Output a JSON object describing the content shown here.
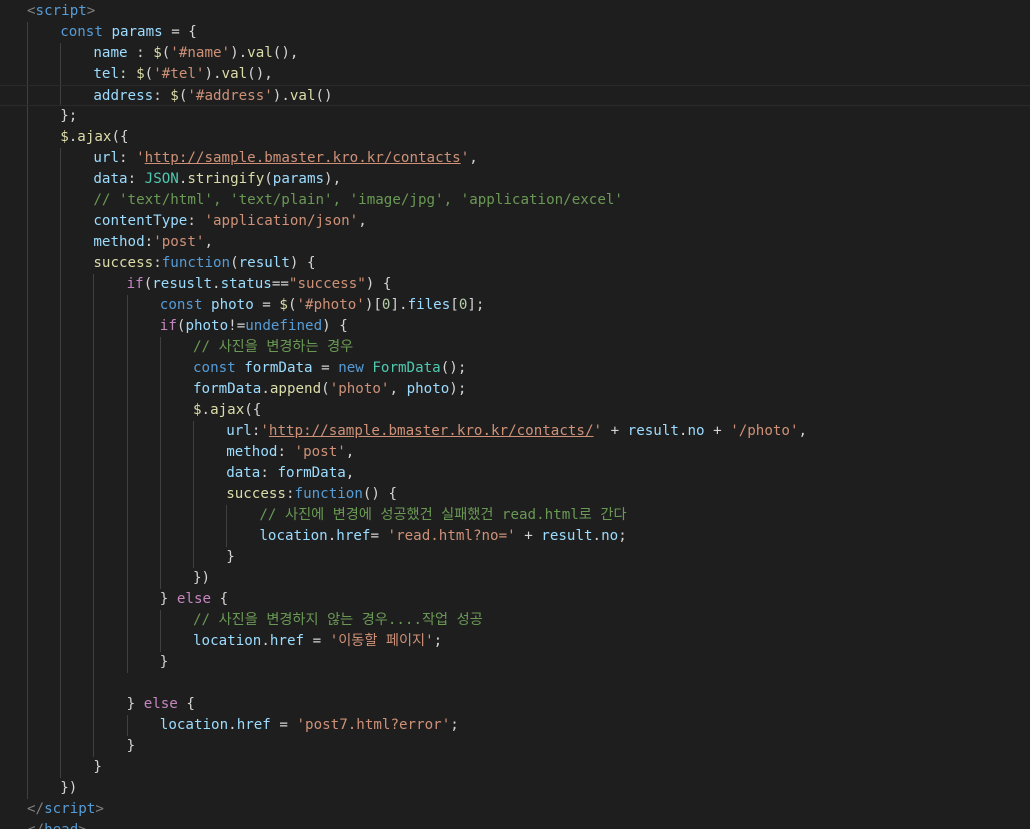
{
  "editor": {
    "language": "html",
    "theme_colors": {
      "background": "#1e1e1e",
      "keyword": "#569cd6",
      "control": "#c586c0",
      "variable": "#9cdcfe",
      "function": "#dcdcaa",
      "string": "#ce9178",
      "number": "#b5cea8",
      "comment": "#6a9955",
      "class": "#4ec9b0",
      "text": "#d4d4d4",
      "tag_bracket": "#808080"
    },
    "current_line_index": 4,
    "lines": [
      {
        "indent": 0,
        "tokens": [
          [
            "tag-bracket",
            "<"
          ],
          [
            "tag",
            "script"
          ],
          [
            "tag-bracket",
            ">"
          ]
        ]
      },
      {
        "indent": 1,
        "tokens": [
          [
            "kw",
            "const "
          ],
          [
            "var",
            "params"
          ],
          [
            "plain",
            " = {"
          ]
        ]
      },
      {
        "indent": 2,
        "tokens": [
          [
            "var",
            "name"
          ],
          [
            "plain",
            " : "
          ],
          [
            "fn",
            "$"
          ],
          [
            "plain",
            "("
          ],
          [
            "str",
            "'#name'"
          ],
          [
            "plain",
            ")."
          ],
          [
            "fn",
            "val"
          ],
          [
            "plain",
            "(),"
          ]
        ]
      },
      {
        "indent": 2,
        "tokens": [
          [
            "var",
            "tel"
          ],
          [
            "plain",
            ": "
          ],
          [
            "fn",
            "$"
          ],
          [
            "plain",
            "("
          ],
          [
            "str",
            "'#tel'"
          ],
          [
            "plain",
            ")."
          ],
          [
            "fn",
            "val"
          ],
          [
            "plain",
            "(),"
          ]
        ]
      },
      {
        "indent": 2,
        "tokens": [
          [
            "var",
            "address"
          ],
          [
            "plain",
            ": "
          ],
          [
            "fn",
            "$"
          ],
          [
            "plain",
            "("
          ],
          [
            "str",
            "'#address'"
          ],
          [
            "plain",
            ")."
          ],
          [
            "fn",
            "val"
          ],
          [
            "plain",
            "()"
          ]
        ]
      },
      {
        "indent": 1,
        "tokens": [
          [
            "plain",
            "};"
          ]
        ]
      },
      {
        "indent": 1,
        "tokens": [
          [
            "fn",
            "$"
          ],
          [
            "plain",
            "."
          ],
          [
            "fn",
            "ajax"
          ],
          [
            "plain",
            "({"
          ]
        ]
      },
      {
        "indent": 2,
        "tokens": [
          [
            "var",
            "url"
          ],
          [
            "plain",
            ": "
          ],
          [
            "str",
            "'"
          ],
          [
            "url",
            "http://sample.bmaster.kro.kr/contacts"
          ],
          [
            "str",
            "'"
          ],
          [
            "plain",
            ","
          ]
        ]
      },
      {
        "indent": 2,
        "tokens": [
          [
            "var",
            "data"
          ],
          [
            "plain",
            ": "
          ],
          [
            "cls",
            "JSON"
          ],
          [
            "plain",
            "."
          ],
          [
            "fn",
            "stringify"
          ],
          [
            "plain",
            "("
          ],
          [
            "var",
            "params"
          ],
          [
            "plain",
            "),"
          ]
        ]
      },
      {
        "indent": 2,
        "tokens": [
          [
            "cmt",
            "// 'text/html', 'text/plain', 'image/jpg', 'application/excel'"
          ]
        ]
      },
      {
        "indent": 2,
        "tokens": [
          [
            "var",
            "contentType"
          ],
          [
            "plain",
            ": "
          ],
          [
            "str",
            "'application/json'"
          ],
          [
            "plain",
            ","
          ]
        ]
      },
      {
        "indent": 2,
        "tokens": [
          [
            "var",
            "method"
          ],
          [
            "plain",
            ":"
          ],
          [
            "str",
            "'post'"
          ],
          [
            "plain",
            ","
          ]
        ]
      },
      {
        "indent": 2,
        "tokens": [
          [
            "fn",
            "success"
          ],
          [
            "plain",
            ":"
          ],
          [
            "kw",
            "function"
          ],
          [
            "plain",
            "("
          ],
          [
            "var",
            "result"
          ],
          [
            "plain",
            ") {"
          ]
        ]
      },
      {
        "indent": 3,
        "tokens": [
          [
            "ctrl",
            "if"
          ],
          [
            "plain",
            "("
          ],
          [
            "var",
            "resuslt"
          ],
          [
            "plain",
            "."
          ],
          [
            "var",
            "status"
          ],
          [
            "plain",
            "=="
          ],
          [
            "str",
            "\"success\""
          ],
          [
            "plain",
            ") {"
          ]
        ]
      },
      {
        "indent": 4,
        "tokens": [
          [
            "kw",
            "const "
          ],
          [
            "var",
            "photo"
          ],
          [
            "plain",
            " = "
          ],
          [
            "fn",
            "$"
          ],
          [
            "plain",
            "("
          ],
          [
            "str",
            "'#photo'"
          ],
          [
            "plain",
            ")["
          ],
          [
            "num",
            "0"
          ],
          [
            "plain",
            "]."
          ],
          [
            "var",
            "files"
          ],
          [
            "plain",
            "["
          ],
          [
            "num",
            "0"
          ],
          [
            "plain",
            "];"
          ]
        ]
      },
      {
        "indent": 4,
        "tokens": [
          [
            "ctrl",
            "if"
          ],
          [
            "plain",
            "("
          ],
          [
            "var",
            "photo"
          ],
          [
            "plain",
            "!="
          ],
          [
            "kw",
            "undefined"
          ],
          [
            "plain",
            ") {"
          ]
        ]
      },
      {
        "indent": 5,
        "tokens": [
          [
            "cmt",
            "// 사진을 변경하는 경우"
          ]
        ]
      },
      {
        "indent": 5,
        "tokens": [
          [
            "kw",
            "const "
          ],
          [
            "var",
            "formData"
          ],
          [
            "plain",
            " = "
          ],
          [
            "kw",
            "new "
          ],
          [
            "cls",
            "FormData"
          ],
          [
            "plain",
            "();"
          ]
        ]
      },
      {
        "indent": 5,
        "tokens": [
          [
            "var",
            "formData"
          ],
          [
            "plain",
            "."
          ],
          [
            "fn",
            "append"
          ],
          [
            "plain",
            "("
          ],
          [
            "str",
            "'photo'"
          ],
          [
            "plain",
            ", "
          ],
          [
            "var",
            "photo"
          ],
          [
            "plain",
            ");"
          ]
        ]
      },
      {
        "indent": 5,
        "tokens": [
          [
            "fn",
            "$"
          ],
          [
            "plain",
            "."
          ],
          [
            "fn",
            "ajax"
          ],
          [
            "plain",
            "({"
          ]
        ]
      },
      {
        "indent": 6,
        "tokens": [
          [
            "var",
            "url"
          ],
          [
            "plain",
            ":"
          ],
          [
            "str",
            "'"
          ],
          [
            "url",
            "http://sample.bmaster.kro.kr/contacts/"
          ],
          [
            "str",
            "'"
          ],
          [
            "plain",
            " + "
          ],
          [
            "var",
            "result"
          ],
          [
            "plain",
            "."
          ],
          [
            "var",
            "no"
          ],
          [
            "plain",
            " + "
          ],
          [
            "str",
            "'/photo'"
          ],
          [
            "plain",
            ","
          ]
        ]
      },
      {
        "indent": 6,
        "tokens": [
          [
            "var",
            "method"
          ],
          [
            "plain",
            ": "
          ],
          [
            "str",
            "'post'"
          ],
          [
            "plain",
            ","
          ]
        ]
      },
      {
        "indent": 6,
        "tokens": [
          [
            "var",
            "data"
          ],
          [
            "plain",
            ": "
          ],
          [
            "var",
            "formData"
          ],
          [
            "plain",
            ","
          ]
        ]
      },
      {
        "indent": 6,
        "tokens": [
          [
            "fn",
            "success"
          ],
          [
            "plain",
            ":"
          ],
          [
            "kw",
            "function"
          ],
          [
            "plain",
            "() {"
          ]
        ]
      },
      {
        "indent": 7,
        "tokens": [
          [
            "cmt",
            "// 사진에 변경에 성공했건 실패했건 read.html로 간다"
          ]
        ]
      },
      {
        "indent": 7,
        "tokens": [
          [
            "var",
            "location"
          ],
          [
            "plain",
            "."
          ],
          [
            "var",
            "href"
          ],
          [
            "plain",
            "= "
          ],
          [
            "str",
            "'read.html?no='"
          ],
          [
            "plain",
            " + "
          ],
          [
            "var",
            "result"
          ],
          [
            "plain",
            "."
          ],
          [
            "var",
            "no"
          ],
          [
            "plain",
            ";"
          ]
        ]
      },
      {
        "indent": 6,
        "tokens": [
          [
            "plain",
            "}"
          ]
        ]
      },
      {
        "indent": 5,
        "tokens": [
          [
            "plain",
            "})"
          ]
        ]
      },
      {
        "indent": 4,
        "tokens": [
          [
            "plain",
            "} "
          ],
          [
            "ctrl",
            "else"
          ],
          [
            "plain",
            " {"
          ]
        ]
      },
      {
        "indent": 5,
        "tokens": [
          [
            "cmt",
            "// 사진을 변경하지 않는 경우....작업 성공"
          ]
        ]
      },
      {
        "indent": 5,
        "tokens": [
          [
            "var",
            "location"
          ],
          [
            "plain",
            "."
          ],
          [
            "var",
            "href"
          ],
          [
            "plain",
            " = "
          ],
          [
            "str",
            "'이동할 페이지'"
          ],
          [
            "plain",
            ";"
          ]
        ]
      },
      {
        "indent": 4,
        "tokens": [
          [
            "plain",
            "}"
          ]
        ]
      },
      {
        "indent": 0,
        "tokens": []
      },
      {
        "indent": 3,
        "tokens": [
          [
            "plain",
            "} "
          ],
          [
            "ctrl",
            "else"
          ],
          [
            "plain",
            " {"
          ]
        ]
      },
      {
        "indent": 4,
        "tokens": [
          [
            "var",
            "location"
          ],
          [
            "plain",
            "."
          ],
          [
            "var",
            "href"
          ],
          [
            "plain",
            " = "
          ],
          [
            "str",
            "'post7.html?error'"
          ],
          [
            "plain",
            ";"
          ]
        ]
      },
      {
        "indent": 3,
        "tokens": [
          [
            "plain",
            "}"
          ]
        ]
      },
      {
        "indent": 2,
        "tokens": [
          [
            "plain",
            "}"
          ]
        ]
      },
      {
        "indent": 1,
        "tokens": [
          [
            "plain",
            "})"
          ]
        ]
      },
      {
        "indent": 0,
        "tokens": [
          [
            "tag-bracket",
            "</"
          ],
          [
            "tag",
            "script"
          ],
          [
            "tag-bracket",
            ">"
          ]
        ]
      },
      {
        "indent": 0,
        "tokens": [
          [
            "tag-bracket",
            "</"
          ],
          [
            "tag",
            "head"
          ],
          [
            "tag-bracket",
            ">"
          ]
        ]
      }
    ]
  }
}
